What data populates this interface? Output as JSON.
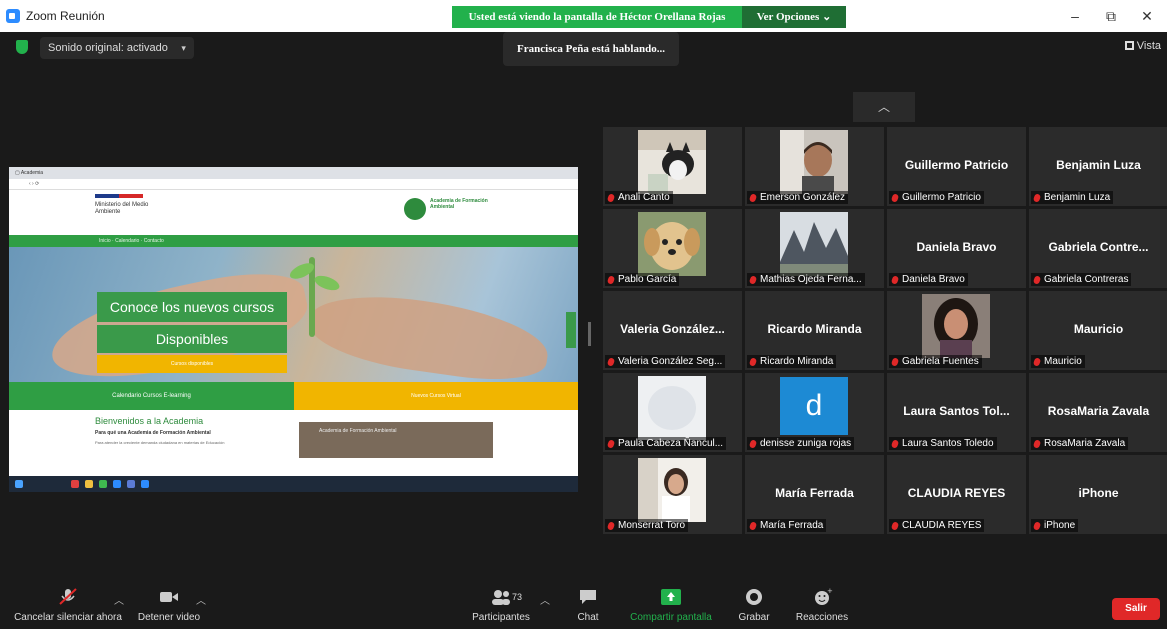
{
  "window": {
    "title": "Zoom Reunión",
    "share_banner": "Usted está viendo la pantalla de Héctor Orellana Rojas",
    "view_options": "Ver Opciones",
    "minimize": "–",
    "maximize": "⧉",
    "close": "✕"
  },
  "topbar": {
    "sound": "Sonido original: activado",
    "speaking": "Francisca Peña está hablando...",
    "vista": "Vista"
  },
  "shared_screen": {
    "ministerio": "Ministerio del Medio Ambiente",
    "academia": "Academia de Formación Ambiental",
    "nav": "Inicio · Calendario · Contacto",
    "cta_line1": "Conoce los nuevos cursos",
    "cta_line2": "Disponibles",
    "cta_small": "Cursos disponibles",
    "bar_green": "Calendario Cursos E-learning",
    "bar_yellow": "Nuevos Cursos Virtual",
    "welcome_title": "Bienvenidos a la Academia",
    "welcome_sub": "Para qué una Academia de Formación Ambiental",
    "welcome_body": "Para atender la creciente demanda ciudadana en materias de Educación",
    "video_title": "Academia de Formación Ambiental"
  },
  "participants": [
    {
      "label": "Anali Canto",
      "big": "",
      "photo": "cat"
    },
    {
      "label": "Emerson González",
      "big": "",
      "photo": "man"
    },
    {
      "label": "Guillermo Patricio",
      "big": "Guillermo Patricio",
      "photo": ""
    },
    {
      "label": "Benjamin Luza",
      "big": "Benjamin Luza",
      "photo": ""
    },
    {
      "label": "Pablo García",
      "big": "",
      "photo": "dog"
    },
    {
      "label": "Mathias Ojeda Ferna...",
      "big": "",
      "photo": "mountain"
    },
    {
      "label": "Daniela Bravo",
      "big": "Daniela Bravo",
      "photo": ""
    },
    {
      "label": "Gabriela Contreras",
      "big": "Gabriela Contre...",
      "photo": ""
    },
    {
      "label": "Valeria González Seg...",
      "big": "Valeria González...",
      "photo": ""
    },
    {
      "label": "Ricardo Miranda",
      "big": "Ricardo Miranda",
      "photo": ""
    },
    {
      "label": "Gabriela Fuentes",
      "big": "",
      "photo": "woman"
    },
    {
      "label": "Mauricio",
      "big": "Mauricio",
      "photo": ""
    },
    {
      "label": "Paula Cabeza Ñancul...",
      "big": "",
      "photo": "blur"
    },
    {
      "label": "denisse zuniga rojas",
      "big": "",
      "photo": "d"
    },
    {
      "label": "Laura Santos Toledo",
      "big": "Laura Santos Tol...",
      "photo": ""
    },
    {
      "label": "RosaMaria Zavala",
      "big": "RosaMaria Zavala",
      "photo": ""
    },
    {
      "label": "Monserrat Toro",
      "big": "",
      "photo": "girl"
    },
    {
      "label": "María Ferrada",
      "big": "María Ferrada",
      "photo": ""
    },
    {
      "label": "CLAUDIA REYES",
      "big": "CLAUDIA REYES",
      "photo": ""
    },
    {
      "label": "iPhone",
      "big": "iPhone",
      "photo": ""
    }
  ],
  "avatar_letter": "d",
  "toolbar": {
    "mute": "Cancelar silenciar ahora",
    "video": "Detener video",
    "participants": "Participantes",
    "participants_count": "73",
    "chat": "Chat",
    "share": "Compartir pantalla",
    "record": "Grabar",
    "reactions": "Reacciones",
    "leave": "Salir"
  },
  "colors": {
    "banner_green": "#22b14c",
    "leave_red": "#e02828",
    "tile_bg": "#2b2b2b",
    "share_icon": "#22b14c"
  }
}
